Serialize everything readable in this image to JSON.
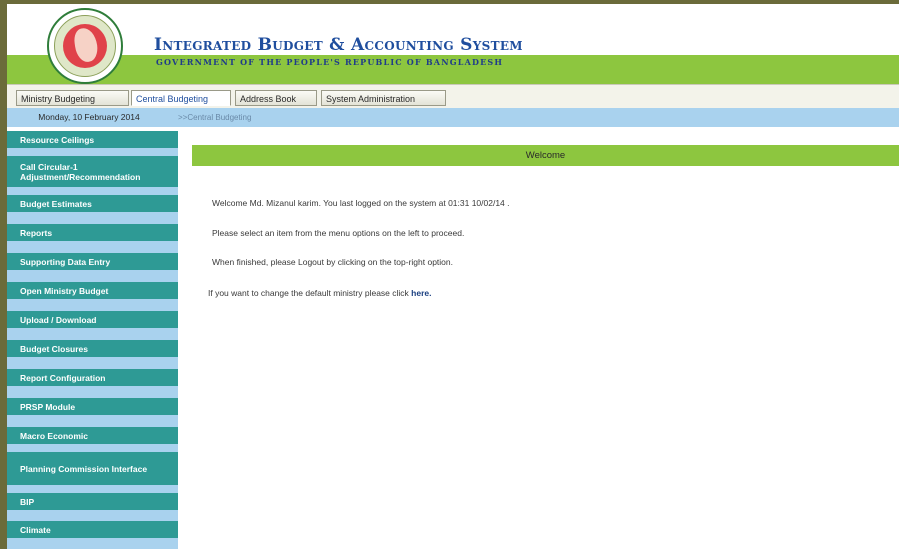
{
  "header": {
    "title": "Integrated Budget & Accounting System",
    "subtitle": "GOVERNMENT OF THE PEOPLE'S REPUBLIC OF BANGLADESH"
  },
  "tabs": [
    {
      "label": "Ministry Budgeting",
      "active": false
    },
    {
      "label": "Central Budgeting",
      "active": true
    },
    {
      "label": "Address Book",
      "active": false
    },
    {
      "label": "System Administration",
      "active": false
    }
  ],
  "datebar": {
    "date": "Monday, 10 February 2014",
    "breadcrumb": ">>Central Budgeting"
  },
  "sidebar": {
    "items": [
      {
        "label": "Resource Ceilings"
      },
      {
        "label": "Call Circular-1 Adjustment/Recommendation"
      },
      {
        "label": "Budget Estimates"
      },
      {
        "label": "Reports"
      },
      {
        "label": "Supporting Data Entry"
      },
      {
        "label": "Open Ministry Budget"
      },
      {
        "label": "Upload / Download"
      },
      {
        "label": "Budget Closures"
      },
      {
        "label": "Report Configuration"
      },
      {
        "label": "PRSP Module"
      },
      {
        "label": "Macro Economic"
      },
      {
        "label": "Planning Commission Interface"
      },
      {
        "label": "BIP"
      },
      {
        "label": "Climate"
      }
    ]
  },
  "main": {
    "welcome_title": "Welcome",
    "messages": [
      "Welcome Md. Mizanul karim. You last logged on the system at 01:31 10/02/14 .",
      "Please select an item from the menu options on the left to proceed.",
      "When finished, please Logout by clicking on the top-right option."
    ],
    "change_text": "If you want to change the default ministry please click ",
    "change_link": "here."
  },
  "colors": {
    "header_green": "#8dc63f",
    "nav_teal": "#2e9a95",
    "datebar_blue": "#a9d2ee",
    "title_blue": "#1f4e9e"
  }
}
